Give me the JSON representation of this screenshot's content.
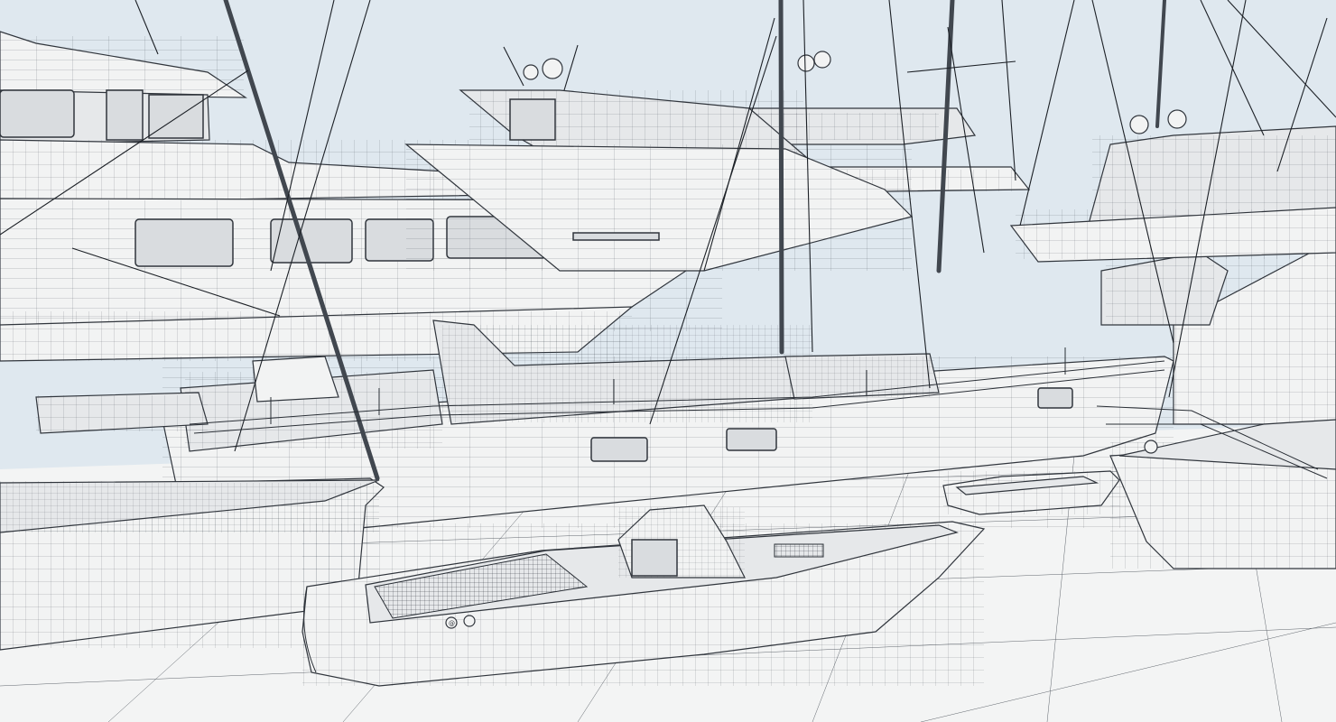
{
  "scene": {
    "kind": "wireframe-3d-render",
    "subject": "marina-with-yachts-and-tender",
    "colors": {
      "sky": "#dfe8ef",
      "ground": "#f3f4f4",
      "hull": "#f2f3f3",
      "wire": "#2a2f36"
    },
    "tender_badge": "@"
  }
}
